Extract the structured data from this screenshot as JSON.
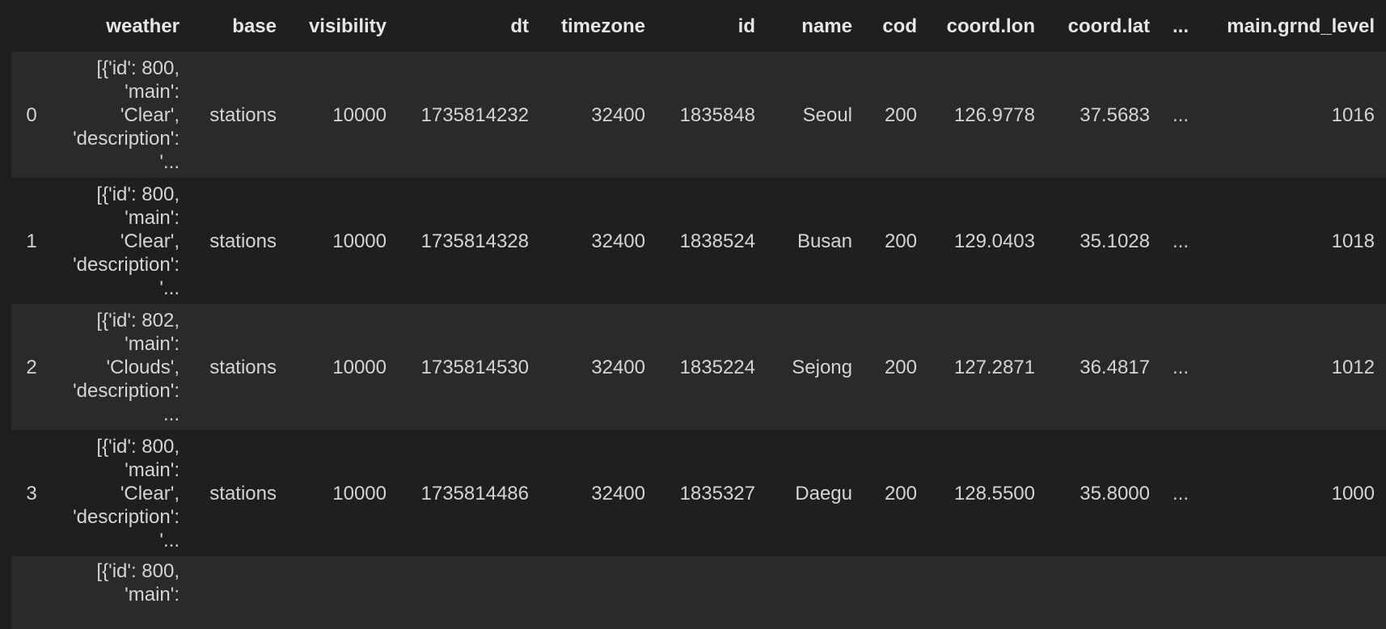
{
  "table": {
    "columns": [
      "",
      "weather",
      "base",
      "visibility",
      "dt",
      "timezone",
      "id",
      "name",
      "cod",
      "coord.lon",
      "coord.lat",
      "...",
      "main.grnd_level"
    ],
    "rows": [
      {
        "index": "0",
        "weather": "[{'id': 800,\n'main':\n'Clear',\n'description':\n'...",
        "base": "stations",
        "visibility": "10000",
        "dt": "1735814232",
        "timezone": "32400",
        "id": "1835848",
        "name": "Seoul",
        "cod": "200",
        "coord_lon": "126.9778",
        "coord_lat": "37.5683",
        "ellipsis": "...",
        "main_grnd_level": "1016"
      },
      {
        "index": "1",
        "weather": "[{'id': 800,\n'main':\n'Clear',\n'description':\n'...",
        "base": "stations",
        "visibility": "10000",
        "dt": "1735814328",
        "timezone": "32400",
        "id": "1838524",
        "name": "Busan",
        "cod": "200",
        "coord_lon": "129.0403",
        "coord_lat": "35.1028",
        "ellipsis": "...",
        "main_grnd_level": "1018"
      },
      {
        "index": "2",
        "weather": "[{'id': 802,\n'main':\n'Clouds',\n'description':\n...",
        "base": "stations",
        "visibility": "10000",
        "dt": "1735814530",
        "timezone": "32400",
        "id": "1835224",
        "name": "Sejong",
        "cod": "200",
        "coord_lon": "127.2871",
        "coord_lat": "36.4817",
        "ellipsis": "...",
        "main_grnd_level": "1012"
      },
      {
        "index": "3",
        "weather": "[{'id': 800,\n'main':\n'Clear',\n'description':\n'...",
        "base": "stations",
        "visibility": "10000",
        "dt": "1735814486",
        "timezone": "32400",
        "id": "1835327",
        "name": "Daegu",
        "cod": "200",
        "coord_lon": "128.5500",
        "coord_lat": "35.8000",
        "ellipsis": "...",
        "main_grnd_level": "1000"
      },
      {
        "index": "",
        "weather": "[{'id': 800,\n'main':",
        "base": "",
        "visibility": "",
        "dt": "",
        "timezone": "",
        "id": "",
        "name": "",
        "cod": "",
        "coord_lon": "",
        "coord_lat": "",
        "ellipsis": "",
        "main_grnd_level": ""
      }
    ]
  }
}
